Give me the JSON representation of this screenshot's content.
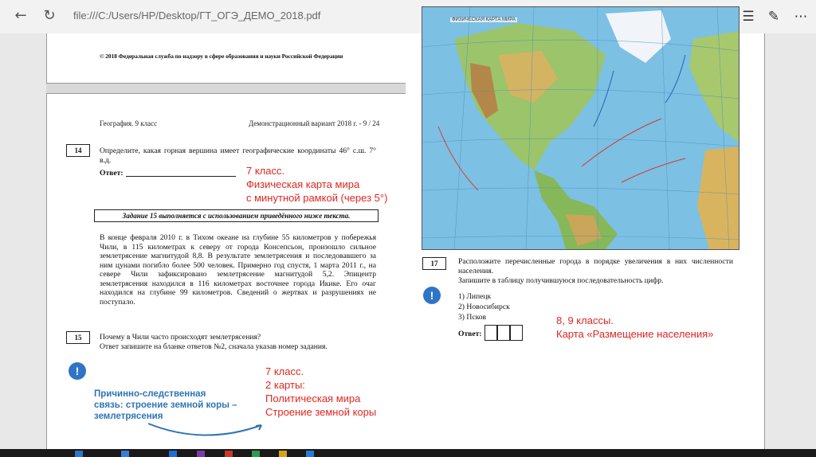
{
  "browser": {
    "url": "file:///C:/Users/HP/Desktop/ГТ_ОГЭ_ДЕМО_2018.pdf",
    "back_icon": "arrow-left-icon",
    "refresh_icon": "refresh-icon"
  },
  "page1": {
    "copyright": "© 2018 Федеральная служба по надзору в сфере образования и науки Российской Федерации"
  },
  "page2": {
    "header_left": "География. 9 класс",
    "header_right": "Демонстрационный вариант 2018 г. - 9 / 24",
    "q14": {
      "number": "14",
      "text": "Определите, какая горная вершина имеет географические координаты 46° с.ш. 7° в.д.",
      "answer_label": "Ответ:"
    },
    "task15_note": "Задание 15 выполняется с использованием приведённого ниже текста.",
    "passage": "В конце февраля 2010 г. в Тихом океане на глубине 55 километров у побережья Чили, в 115 километрах к северу от города Консепсьон, произошло сильное землетрясение магнитудой 8,8. В результате землетрясения и последовавшего за ним цунами погибло более 500 человек. Примерно год спустя, 1 марта 2011 г., на севере Чили зафиксировано землетрясение магнитудой 5,2. Эпицентр землетрясения находился в 116 километрах восточнее города Икике. Его очаг находился на глубине 99 километров. Сведений о жертвах и разрушениях не поступало.",
    "q15": {
      "number": "15",
      "line1": "Почему в Чили часто происходят землетрясения?",
      "line2": "Ответ запишите на бланке ответов №2, сначала указав номер задания."
    }
  },
  "annotations": {
    "alert_symbol": "!",
    "note_7class_map": [
      "7 класс.",
      "Физическая карта мира",
      "с минутной рамкой  (через 5°)"
    ],
    "note_cause": [
      "Причинно-следственная",
      "связь: строение земной коры –",
      "землетрясения"
    ],
    "note_7class_maps": [
      "7 класс.",
      "2 карты:",
      "Политическая мира",
      "Строение земной коры"
    ],
    "note_89class": [
      "8, 9 классы.",
      "Карта «Размещение населения»"
    ],
    "red_color": "#e0261f",
    "blue_color": "#2e74b5"
  },
  "page3": {
    "map_title": "ФИЗИЧЕСКАЯ КАРТА МИРА",
    "q17": {
      "number": "17",
      "line1": "Расположите перечисленные города в порядке увеличения в них численности населения.",
      "line2": "Запишите в таблицу получившуюся последовательность цифр.",
      "options": [
        "1)  Липецк",
        "2)  Новосибирск",
        "3)  Псков"
      ],
      "answer_label": "Ответ:"
    }
  }
}
